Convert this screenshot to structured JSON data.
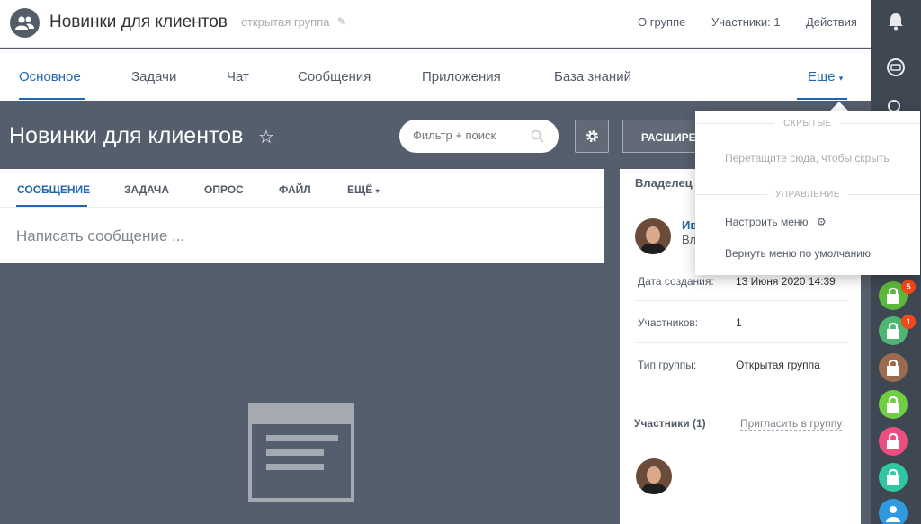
{
  "header": {
    "title": "Новинки для клиентов",
    "group_type": "открытая группа",
    "links": {
      "about": "О группе",
      "members": "Участники: 1",
      "actions": "Действия"
    }
  },
  "tabs": [
    {
      "label": "Основное",
      "active": true
    },
    {
      "label": "Задачи"
    },
    {
      "label": "Чат"
    },
    {
      "label": "Сообщения"
    },
    {
      "label": "Приложения"
    },
    {
      "label": "База знаний"
    },
    {
      "label": "Еще"
    }
  ],
  "page": {
    "title": "Новинки для клиентов",
    "filter_placeholder": "Фильтр + поиск",
    "extended_label": "РАСШИРЕННЫЙ"
  },
  "composer": {
    "tabs": [
      "СООБЩЕНИЕ",
      "ЗАДАЧА",
      "ОПРОС",
      "ФАЙЛ",
      "ЕЩЁ"
    ],
    "placeholder": "Написать сообщение ..."
  },
  "info": {
    "owner_heading": "Владелец",
    "owner_name": "Ив",
    "owner_sub": "Вл",
    "rows": [
      {
        "label": "Дата создания:",
        "value": "13 Июня 2020 14:39"
      },
      {
        "label": "Участников:",
        "value": "1"
      },
      {
        "label": "Тип группы:",
        "value": "Открытая группа"
      }
    ],
    "members_heading": "Участники (1)",
    "invite": "Пригласить в группу"
  },
  "popup": {
    "hidden_heading": "СКРЫТЫЕ",
    "hidden_hint": "Перетащите сюда, чтобы скрыть",
    "manage_heading": "УПРАВЛЕНИЕ",
    "configure": "Настроить меню",
    "reset": "Вернуть меню по умолчанию"
  },
  "rail": {
    "badges": [
      "5",
      "1"
    ],
    "avatar_colors": [
      "#5cb83c",
      "#4fb573",
      "#9b6b4f",
      "#6fce42",
      "#ec4e7f",
      "#2fc6a4",
      "#2f9ae0"
    ]
  },
  "colors": {
    "accent": "#2067b0",
    "background": "#555e6c",
    "rail": "#3f4752"
  }
}
